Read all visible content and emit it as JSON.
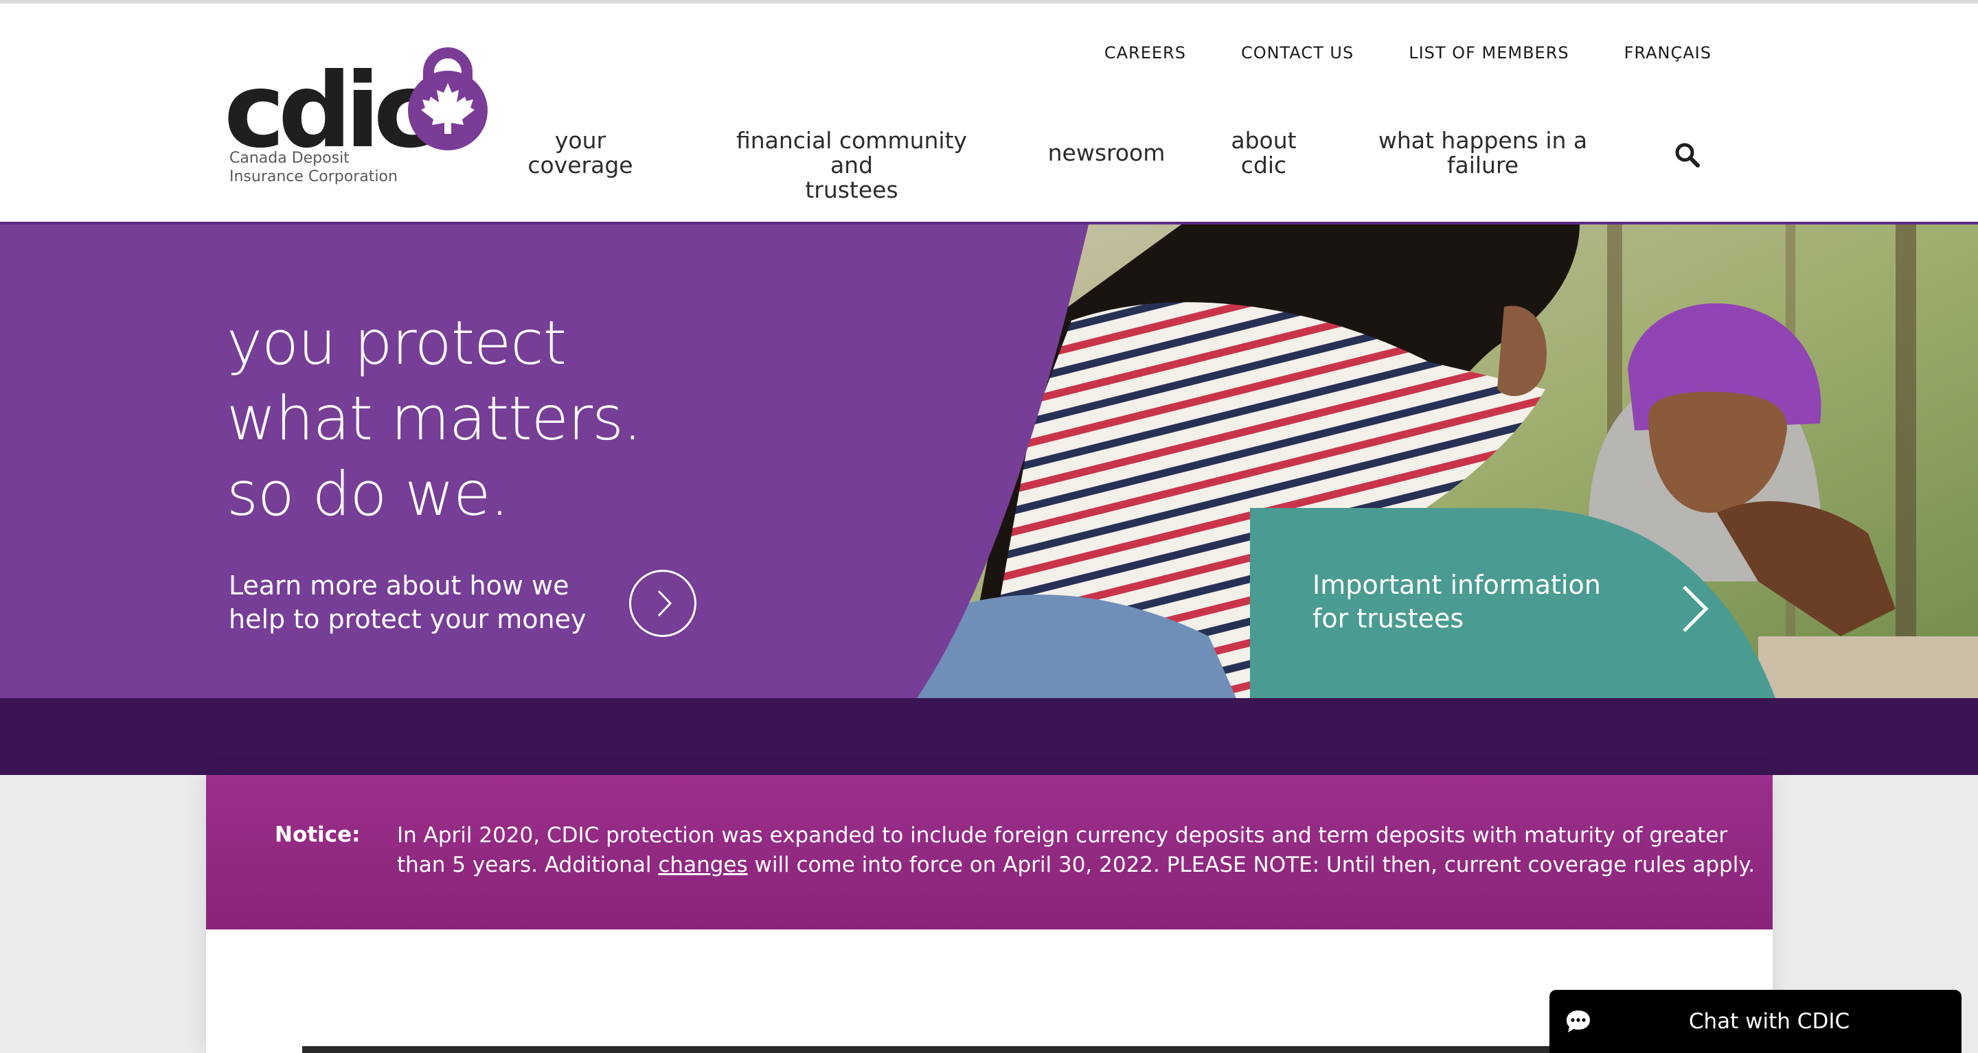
{
  "logo": {
    "wordmark": "cdic",
    "subtitle_line1": "Canada Deposit",
    "subtitle_line2": "Insurance Corporation"
  },
  "utility_nav": [
    "CAREERS",
    "CONTACT US",
    "LIST OF MEMBERS",
    "FRANÇAIS"
  ],
  "main_nav": [
    {
      "line1": "your",
      "line2": "coverage"
    },
    {
      "line1": "financial community and",
      "line2": "trustees"
    },
    {
      "line1": "newsroom",
      "line2": ""
    },
    {
      "line1": "about",
      "line2": "cdic"
    },
    {
      "line1": "what happens in a",
      "line2": "failure"
    }
  ],
  "search_icon": "search-icon",
  "hero": {
    "title_line1": "you protect",
    "title_line2": "what matters.",
    "title_line3": "so do we.",
    "cta_text": "Learn more about how we help to protect your money",
    "trustee_text": "Important information for trustees"
  },
  "notice": {
    "label": "Notice:",
    "text_before": "In April 2020, CDIC protection was expanded to include foreign currency deposits and term deposits with maturity of greater than 5 years. Additional ",
    "link_text": "changes",
    "text_after": " will come into force on April 30, 2022. PLEASE NOTE: Until then, current coverage rules apply."
  },
  "chat": {
    "label": "Chat with CDIC",
    "icon": "chat-bubble-icon"
  },
  "colors": {
    "brand_purple": "#5b2d84",
    "hero_purple": "#7a4199",
    "dark_band": "#3b1453",
    "notice_magenta": "#9b2f8b",
    "teal": "#4a9b92"
  }
}
